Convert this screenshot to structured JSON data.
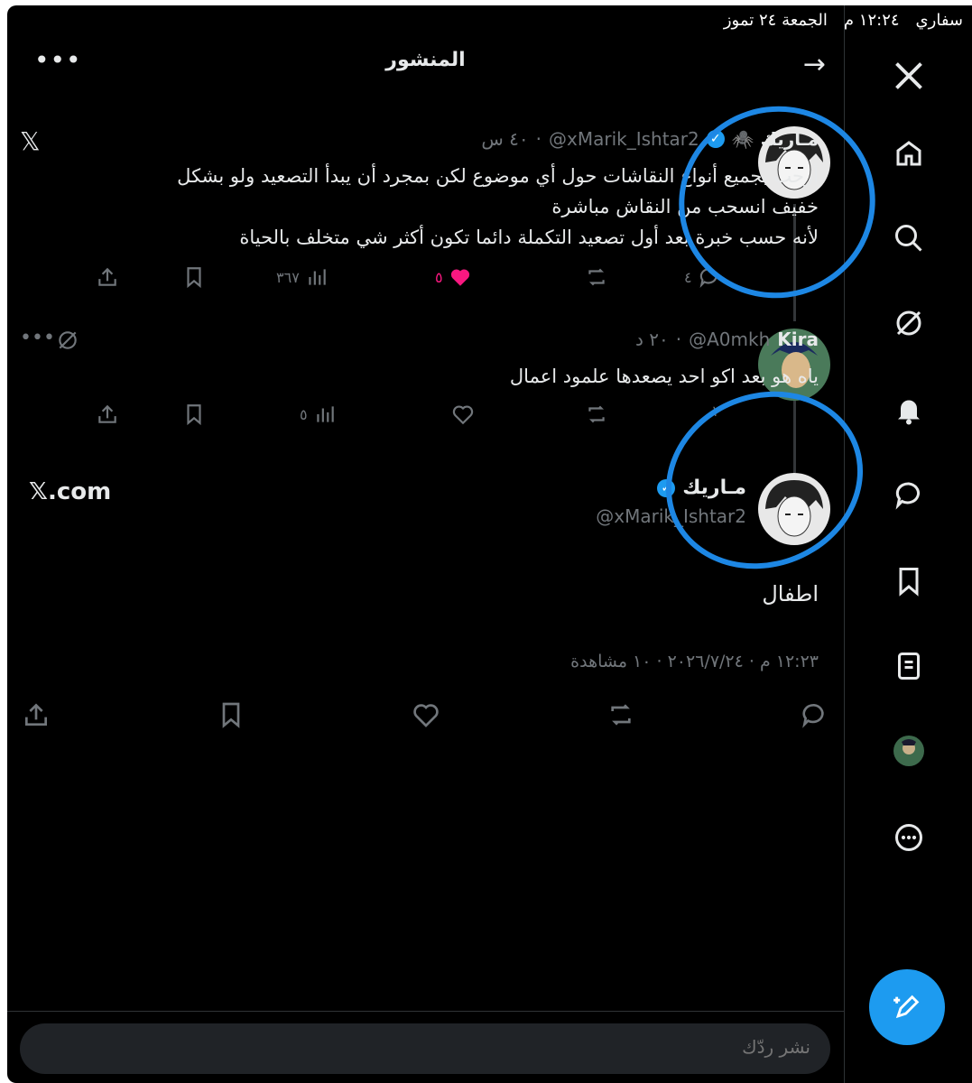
{
  "statusbar": {
    "app": "سفاري",
    "time": "١٢:٢٤ م",
    "date": "الجمعة ٢٤ تموز"
  },
  "header": {
    "title": "المنشور",
    "back_icon": "arrow-right-icon",
    "more_icon": "more-icon"
  },
  "sidebar": {
    "items": [
      {
        "name": "x-logo-icon"
      },
      {
        "name": "home-icon"
      },
      {
        "name": "search-icon"
      },
      {
        "name": "grok-icon"
      },
      {
        "name": "bell-icon"
      },
      {
        "name": "messages-icon"
      },
      {
        "name": "bookmark-icon"
      },
      {
        "name": "lists-icon"
      },
      {
        "name": "profile-avatar"
      },
      {
        "name": "more-circle-icon"
      }
    ]
  },
  "tweet1": {
    "name": "مـاريك 🕷️",
    "handle": "@xMarik_Ishtar2",
    "time": "٤٠ س",
    "lines": [
      "أرحب بجميع أنواع النقاشات حول أي موضوع لكن بمجرد أن يبدأ التصعيد ولو بشكل",
      "خفيف انسحب من النقاش مباشرة",
      "لأنه حسب خبرة بعد أول تصعيد التكملة دائما تكون أكثر شي متخلف بالحياة"
    ],
    "replies": "٤",
    "likes": "٥",
    "views": "٣٦٧"
  },
  "tweet2": {
    "name": "Kira",
    "handle": "@A0mkh",
    "time": "٢٠ د",
    "text": "ياه هو بعد اكو احد يصعدها علمود اعمال",
    "replies": "١",
    "views": "٥"
  },
  "main_tweet": {
    "name": "مـاريك",
    "handle": "@xMarik_Ishtar2",
    "text": "اطفال",
    "meta": "١٢:٢٣ م · ٢٠٢٦/٧/٢٤ · ١٠ مشاهدة",
    "source": "𝕏.com"
  },
  "reply": {
    "placeholder": "نشر ردّك"
  },
  "colors": {
    "accent": "#1d9bf0",
    "like": "#f91880",
    "annotation": "#1d87e4"
  }
}
